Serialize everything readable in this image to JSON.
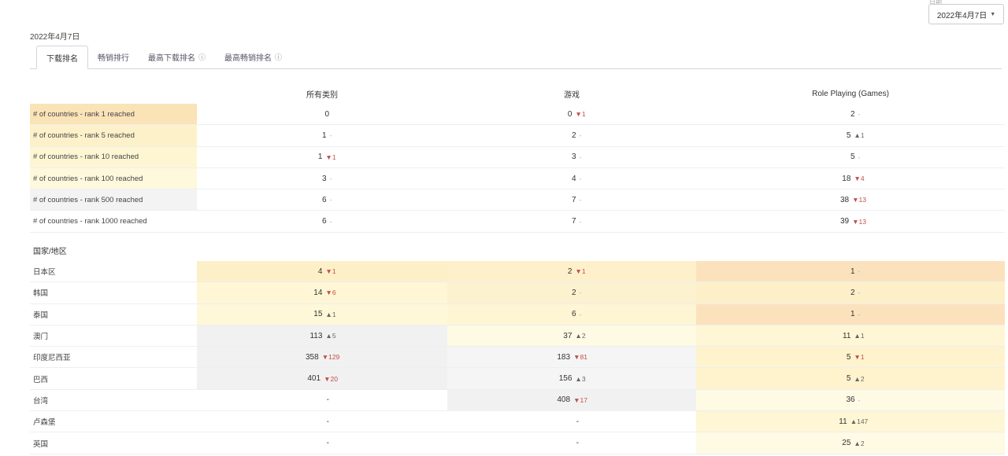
{
  "header": {
    "faint_label": "日期",
    "date_label": "2022年4月7日",
    "date_select": "2022年4月7日"
  },
  "tabs": [
    {
      "label": "下载排名",
      "active": true,
      "info": false
    },
    {
      "label": "畅销排行",
      "active": false,
      "info": false
    },
    {
      "label": "最高下载排名",
      "active": false,
      "info": true
    },
    {
      "label": "最高畅销排名",
      "active": false,
      "info": true
    }
  ],
  "columns": [
    "所有类别",
    "游戏",
    "Role Playing (Games)"
  ],
  "rank_rows": [
    {
      "label": "# of countries - rank 1 reached",
      "bg": "#fbe3b8",
      "cells": [
        {
          "v": "0",
          "c": "",
          "d": ""
        },
        {
          "v": "0",
          "c": "▼1",
          "d": "down"
        },
        {
          "v": "2",
          "c": "-",
          "d": "flat"
        }
      ]
    },
    {
      "label": "# of countries - rank 5 reached",
      "bg": "#fdf1c9",
      "cells": [
        {
          "v": "1",
          "c": "-",
          "d": "flat"
        },
        {
          "v": "2",
          "c": "-",
          "d": "flat"
        },
        {
          "v": "5",
          "c": "▲1",
          "d": "up"
        }
      ]
    },
    {
      "label": "# of countries - rank 10 reached",
      "bg": "#fef6d3",
      "cells": [
        {
          "v": "1",
          "c": "▼1",
          "d": "down"
        },
        {
          "v": "3",
          "c": "-",
          "d": "flat"
        },
        {
          "v": "5",
          "c": "-",
          "d": "flat"
        }
      ]
    },
    {
      "label": "# of countries - rank 100 reached",
      "bg": "#fef8dc",
      "cells": [
        {
          "v": "3",
          "c": "-",
          "d": "flat"
        },
        {
          "v": "4",
          "c": "-",
          "d": "flat"
        },
        {
          "v": "18",
          "c": "▼4",
          "d": "down"
        }
      ]
    },
    {
      "label": "# of countries - rank 500 reached",
      "bg": "#f3f3f3",
      "cells": [
        {
          "v": "6",
          "c": "-",
          "d": "flat"
        },
        {
          "v": "7",
          "c": "-",
          "d": "flat"
        },
        {
          "v": "38",
          "c": "▼13",
          "d": "down"
        }
      ]
    },
    {
      "label": "# of countries - rank 1000 reached",
      "bg": "#ffffff",
      "cells": [
        {
          "v": "6",
          "c": "-",
          "d": "flat"
        },
        {
          "v": "7",
          "c": "-",
          "d": "flat"
        },
        {
          "v": "39",
          "c": "▼13",
          "d": "down"
        }
      ]
    }
  ],
  "section_title": "国家/地区",
  "country_rows": [
    {
      "label": "日本区",
      "cells": [
        {
          "v": "4",
          "c": "▼1",
          "d": "down",
          "bg": "#fdefc8"
        },
        {
          "v": "2",
          "c": "▼1",
          "d": "down",
          "bg": "#fdf0ca"
        },
        {
          "v": "1",
          "c": "-",
          "d": "flat",
          "bg": "#fbe2bd"
        }
      ]
    },
    {
      "label": "韩国",
      "cells": [
        {
          "v": "14",
          "c": "▼6",
          "d": "down",
          "bg": "#fef6d4"
        },
        {
          "v": "2",
          "c": "-",
          "d": "flat",
          "bg": "#fdf2cf"
        },
        {
          "v": "2",
          "c": "-",
          "d": "flat",
          "bg": "#fdefc7"
        }
      ]
    },
    {
      "label": "泰国",
      "cells": [
        {
          "v": "15",
          "c": "▲1",
          "d": "up",
          "bg": "#fef7d8"
        },
        {
          "v": "6",
          "c": "-",
          "d": "flat",
          "bg": "#fef5d4"
        },
        {
          "v": "1",
          "c": "-",
          "d": "flat",
          "bg": "#fbe2bd"
        }
      ]
    },
    {
      "label": "澳门",
      "cells": [
        {
          "v": "113",
          "c": "▲5",
          "d": "up",
          "bg": "#f1f1f1"
        },
        {
          "v": "37",
          "c": "▲2",
          "d": "up",
          "bg": "#fefae3"
        },
        {
          "v": "11",
          "c": "▲1",
          "d": "up",
          "bg": "#fef6d4"
        }
      ]
    },
    {
      "label": "印度尼西亚",
      "cells": [
        {
          "v": "358",
          "c": "▼129",
          "d": "down",
          "bg": "#f1f1f1"
        },
        {
          "v": "183",
          "c": "▼81",
          "d": "down",
          "bg": "#f5f5f5"
        },
        {
          "v": "5",
          "c": "▼1",
          "d": "down",
          "bg": "#fef3cd"
        }
      ]
    },
    {
      "label": "巴西",
      "cells": [
        {
          "v": "401",
          "c": "▼20",
          "d": "down",
          "bg": "#f1f1f1"
        },
        {
          "v": "156",
          "c": "▲3",
          "d": "up",
          "bg": "#f5f5f5"
        },
        {
          "v": "5",
          "c": "▲2",
          "d": "up",
          "bg": "#fef3cd"
        }
      ]
    },
    {
      "label": "台湾",
      "cells": [
        {
          "v": "-",
          "c": "",
          "d": "",
          "bg": "#ffffff"
        },
        {
          "v": "408",
          "c": "▼17",
          "d": "down",
          "bg": "#f1f1f1"
        },
        {
          "v": "36",
          "c": "-",
          "d": "flat",
          "bg": "#fefae3"
        }
      ]
    },
    {
      "label": "卢森堡",
      "cells": [
        {
          "v": "-",
          "c": "",
          "d": "",
          "bg": "#ffffff"
        },
        {
          "v": "-",
          "c": "",
          "d": "",
          "bg": "#ffffff"
        },
        {
          "v": "11",
          "c": "▲147",
          "d": "up",
          "bg": "#fef6d4"
        }
      ]
    },
    {
      "label": "英国",
      "cells": [
        {
          "v": "-",
          "c": "",
          "d": "",
          "bg": "#ffffff"
        },
        {
          "v": "-",
          "c": "",
          "d": "",
          "bg": "#ffffff"
        },
        {
          "v": "25",
          "c": "▲2",
          "d": "up",
          "bg": "#fefae3"
        }
      ]
    }
  ]
}
